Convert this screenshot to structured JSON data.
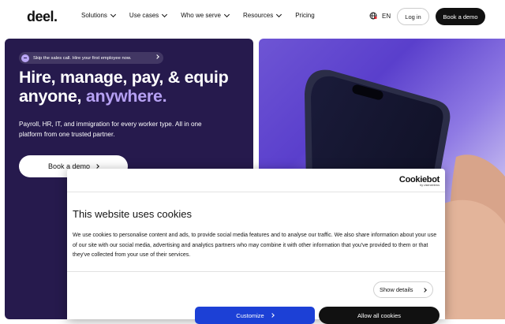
{
  "nav": {
    "logo": "deel.",
    "items": [
      {
        "label": "Solutions",
        "has_dropdown": true
      },
      {
        "label": "Use cases",
        "has_dropdown": true
      },
      {
        "label": "Who we serve",
        "has_dropdown": true
      },
      {
        "label": "Resources",
        "has_dropdown": true
      },
      {
        "label": "Pricing",
        "has_dropdown": false
      }
    ],
    "language": "EN",
    "login_label": "Log in",
    "demo_label": "Book a demo"
  },
  "hero": {
    "pill_text": "Skip the sales call. Hire your first employee now.",
    "headline_part1": "Hire, manage, pay, & equip anyone, ",
    "headline_accent": "anywhere.",
    "subtext": "Payroll, HR, IT, and immigration for every worker type. All in one platform from one trusted partner.",
    "cta_label": "Book a demo"
  },
  "cookie": {
    "brand": "Cookiebot",
    "brand_sub": "by Usercentrics",
    "title": "This website uses cookies",
    "body": "We use cookies to personalise content and ads, to provide social media features and to analyse our traffic. We also share information about your use of our site with our social media, advertising and analytics partners who may combine it with other information that you've provided to them or that they've collected from your use of their services.",
    "details_label": "Show details",
    "customize_label": "Customize",
    "allow_label": "Allow all cookies"
  },
  "colors": {
    "hero_bg": "#261a4d",
    "accent": "#b6a1f3",
    "customize_btn": "#1c40d6",
    "dark_btn": "#111111"
  }
}
